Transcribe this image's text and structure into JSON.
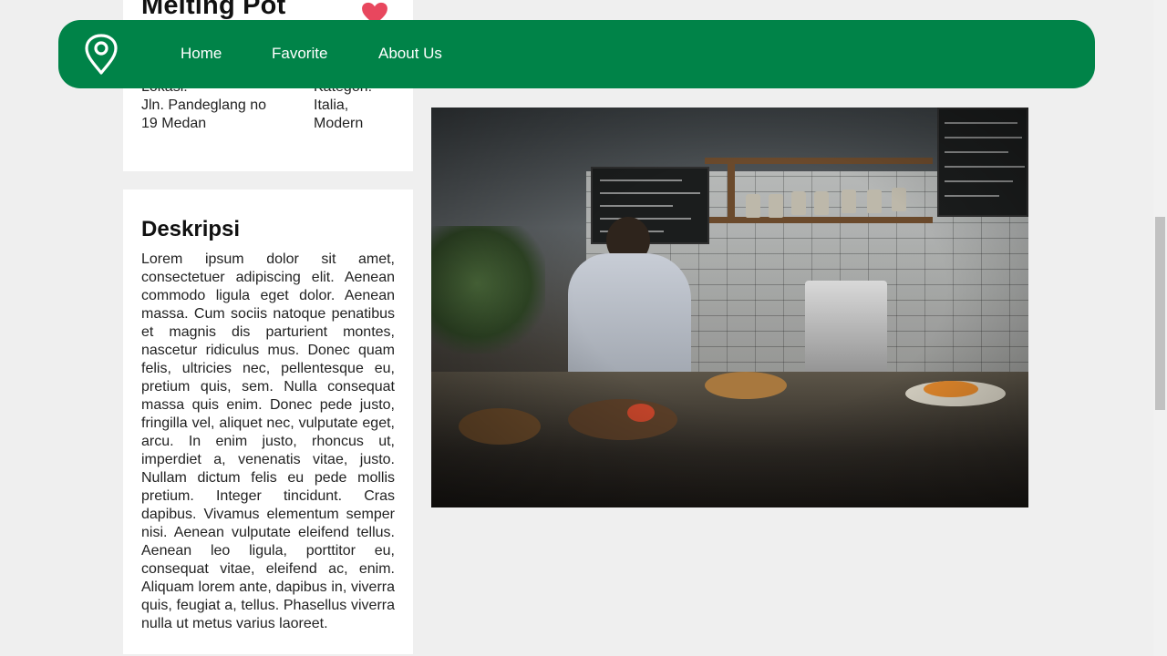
{
  "restaurant": {
    "name": "Melting Pot",
    "location_label": "Lokasi:",
    "location_value": "Jln. Pandeglang no 19 Medan",
    "category_label": "Kategori:",
    "category_value": "Italia, Modern"
  },
  "description": {
    "title": "Deskripsi",
    "body": "Lorem ipsum dolor sit amet, consectetuer adipiscing elit. Aenean commodo ligula eget dolor. Aenean massa. Cum sociis natoque penatibus et magnis dis parturient montes, nascetur ridiculus mus. Donec quam felis, ultricies nec, pellentesque eu, pretium quis, sem. Nulla consequat massa quis enim. Donec pede justo, fringilla vel, aliquet nec, vulputate eget, arcu. In enim justo, rhoncus ut, imperdiet a, venenatis vitae, justo. Nullam dictum felis eu pede mollis pretium. Integer tincidunt. Cras dapibus. Vivamus elementum semper nisi. Aenean vulputate eleifend tellus. Aenean leo ligula, porttitor eu, consequat vitae, eleifend ac, enim. Aliquam lorem ante, dapibus in, viverra quis, feugiat a, tellus. Phasellus viverra nulla ut metus varius laoreet."
  },
  "nav": {
    "links": [
      "Home",
      "Favorite",
      "About Us"
    ],
    "logo_icon": "map-pin-icon"
  },
  "icons": {
    "favorite": "heart-icon"
  },
  "colors": {
    "nav_background": "#008348",
    "nav_text": "#ffffff",
    "heart": "#e8475e",
    "page_background": "#efefef",
    "card_background": "#ffffff"
  }
}
